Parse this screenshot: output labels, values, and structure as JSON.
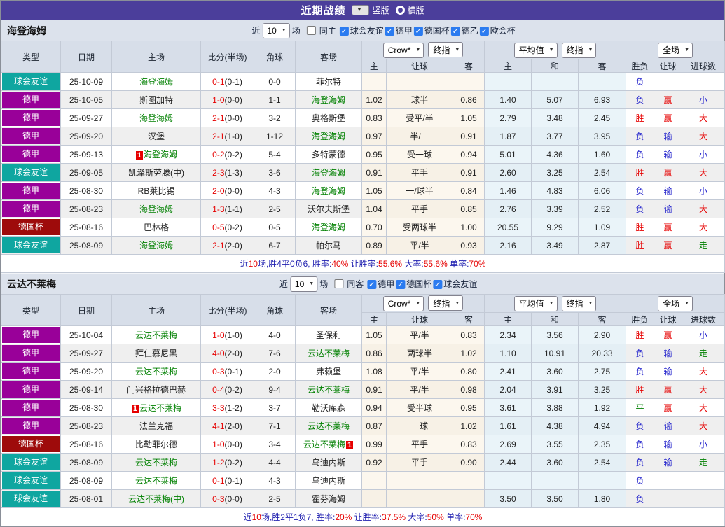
{
  "title_bar": {
    "title": "近期战绩",
    "layout_vertical_label": "竖版",
    "layout_horizontal_label": "横版",
    "selected_layout": "竖版"
  },
  "filter_labels": {
    "near": "近",
    "games": "场"
  },
  "selects": {
    "count": "10",
    "crow": "Crow*",
    "final": "终指",
    "avg": "平均值",
    "final2": "终指",
    "fulltime": "全场"
  },
  "table_labels": {
    "type": "类型",
    "date": "日期",
    "home": "主场",
    "score": "比分(半场)",
    "corner": "角球",
    "away": "客场",
    "h": "主",
    "handicap": "让球",
    "a": "客",
    "avg_h": "主",
    "draw": "和",
    "avg_a": "客",
    "wdl": "胜负",
    "handicap_res": "让球",
    "goals": "进球数"
  },
  "colors": {
    "titlebar": "#4b3e9b",
    "focus_team": "#008000",
    "score_red": "#e60000",
    "badge_red": "#e60000",
    "type_colors": {
      "球会友谊": "#0fa6a0",
      "德甲": "#990099",
      "德国杯": "#9e0b0b"
    },
    "result_colors": {
      "胜": "#e60000",
      "赢": "#e60000",
      "大": "#e60000",
      "负": "#2323cc",
      "输": "#2323cc",
      "小": "#2323cc",
      "平": "#008000",
      "走": "#008000"
    }
  },
  "sections": [
    {
      "team": "海登海姆",
      "filter": {
        "same_label": "同主",
        "same_checked": false,
        "leagues": [
          "球会友谊",
          "德甲",
          "德国杯",
          "德乙",
          "欧会杯"
        ]
      },
      "rows": [
        {
          "type": "球会友谊",
          "date": "25-10-09",
          "home": "海登海姆",
          "home_badge": "",
          "score_ft": "0-1",
          "score_ht": "(0-1)",
          "corners": "0-0",
          "away": "菲尔特",
          "away_badge": "",
          "crow": [
            "",
            "",
            ""
          ],
          "avg": [
            "",
            "",
            ""
          ],
          "result": [
            "负",
            "",
            ""
          ]
        },
        {
          "type": "德甲",
          "date": "25-10-05",
          "home": "斯图加特",
          "home_badge": "",
          "score_ft": "1-0",
          "score_ht": "(0-0)",
          "corners": "1-1",
          "away": "海登海姆",
          "away_badge": "",
          "crow": [
            "1.02",
            "球半",
            "0.86"
          ],
          "avg": [
            "1.40",
            "5.07",
            "6.93"
          ],
          "result": [
            "负",
            "赢",
            "小"
          ]
        },
        {
          "type": "德甲",
          "date": "25-09-27",
          "home": "海登海姆",
          "home_badge": "",
          "score_ft": "2-1",
          "score_ht": "(0-0)",
          "corners": "3-2",
          "away": "奥格斯堡",
          "away_badge": "",
          "crow": [
            "0.83",
            "受平/半",
            "1.05"
          ],
          "avg": [
            "2.79",
            "3.48",
            "2.45"
          ],
          "result": [
            "胜",
            "赢",
            "大"
          ]
        },
        {
          "type": "德甲",
          "date": "25-09-20",
          "home": "汉堡",
          "home_badge": "",
          "score_ft": "2-1",
          "score_ht": "(1-0)",
          "corners": "1-12",
          "away": "海登海姆",
          "away_badge": "",
          "crow": [
            "0.97",
            "半/一",
            "0.91"
          ],
          "avg": [
            "1.87",
            "3.77",
            "3.95"
          ],
          "result": [
            "负",
            "输",
            "大"
          ]
        },
        {
          "type": "德甲",
          "date": "25-09-13",
          "home": "海登海姆",
          "home_badge": "1",
          "score_ft": "0-2",
          "score_ht": "(0-2)",
          "corners": "5-4",
          "away": "多特蒙德",
          "away_badge": "",
          "crow": [
            "0.95",
            "受一球",
            "0.94"
          ],
          "avg": [
            "5.01",
            "4.36",
            "1.60"
          ],
          "result": [
            "负",
            "输",
            "小"
          ]
        },
        {
          "type": "球会友谊",
          "date": "25-09-05",
          "home": "凯泽斯劳滕(中)",
          "home_badge": "",
          "score_ft": "2-3",
          "score_ht": "(1-3)",
          "corners": "3-6",
          "away": "海登海姆",
          "away_badge": "",
          "crow": [
            "0.91",
            "平手",
            "0.91"
          ],
          "avg": [
            "2.60",
            "3.25",
            "2.54"
          ],
          "result": [
            "胜",
            "赢",
            "大"
          ]
        },
        {
          "type": "德甲",
          "date": "25-08-30",
          "home": "RB莱比锡",
          "home_badge": "",
          "score_ft": "2-0",
          "score_ht": "(0-0)",
          "corners": "4-3",
          "away": "海登海姆",
          "away_badge": "",
          "crow": [
            "1.05",
            "一/球半",
            "0.84"
          ],
          "avg": [
            "1.46",
            "4.83",
            "6.06"
          ],
          "result": [
            "负",
            "输",
            "小"
          ]
        },
        {
          "type": "德甲",
          "date": "25-08-23",
          "home": "海登海姆",
          "home_badge": "",
          "score_ft": "1-3",
          "score_ht": "(1-1)",
          "corners": "2-5",
          "away": "沃尔夫斯堡",
          "away_badge": "",
          "crow": [
            "1.04",
            "平手",
            "0.85"
          ],
          "avg": [
            "2.76",
            "3.39",
            "2.52"
          ],
          "result": [
            "负",
            "输",
            "大"
          ]
        },
        {
          "type": "德国杯",
          "date": "25-08-16",
          "home": "巴林格",
          "home_badge": "",
          "score_ft": "0-5",
          "score_ht": "(0-2)",
          "corners": "0-5",
          "away": "海登海姆",
          "away_badge": "",
          "crow": [
            "0.70",
            "受两球半",
            "1.00"
          ],
          "avg": [
            "20.55",
            "9.29",
            "1.09"
          ],
          "result": [
            "胜",
            "赢",
            "大"
          ]
        },
        {
          "type": "球会友谊",
          "date": "25-08-09",
          "home": "海登海姆",
          "home_badge": "",
          "score_ft": "2-1",
          "score_ht": "(2-0)",
          "corners": "6-7",
          "away": "帕尔马",
          "away_badge": "",
          "crow": [
            "0.89",
            "平/半",
            "0.93"
          ],
          "avg": [
            "2.16",
            "3.49",
            "2.87"
          ],
          "result": [
            "胜",
            "赢",
            "走"
          ]
        }
      ],
      "summary": [
        [
          "近",
          "n"
        ],
        [
          "10",
          "r"
        ],
        [
          "场,胜4平0负6, 胜率:",
          "n"
        ],
        [
          "40%",
          "r"
        ],
        [
          " 让胜率:",
          "n"
        ],
        [
          "55.6%",
          "r"
        ],
        [
          " 大率:",
          "n"
        ],
        [
          "55.6%",
          "r"
        ],
        [
          " 单率:",
          "n"
        ],
        [
          "70%",
          "r"
        ]
      ]
    },
    {
      "team": "云达不莱梅",
      "filter": {
        "same_label": "同客",
        "same_checked": false,
        "leagues": [
          "德甲",
          "德国杯",
          "球会友谊"
        ]
      },
      "rows": [
        {
          "type": "德甲",
          "date": "25-10-04",
          "home": "云达不莱梅",
          "home_badge": "",
          "score_ft": "1-0",
          "score_ht": "(1-0)",
          "corners": "4-0",
          "away": "圣保利",
          "away_badge": "",
          "crow": [
            "1.05",
            "平/半",
            "0.83"
          ],
          "avg": [
            "2.34",
            "3.56",
            "2.90"
          ],
          "result": [
            "胜",
            "赢",
            "小"
          ]
        },
        {
          "type": "德甲",
          "date": "25-09-27",
          "home": "拜仁慕尼黑",
          "home_badge": "",
          "score_ft": "4-0",
          "score_ht": "(2-0)",
          "corners": "7-6",
          "away": "云达不莱梅",
          "away_badge": "",
          "crow": [
            "0.86",
            "两球半",
            "1.02"
          ],
          "avg": [
            "1.10",
            "10.91",
            "20.33"
          ],
          "result": [
            "负",
            "输",
            "走"
          ]
        },
        {
          "type": "德甲",
          "date": "25-09-20",
          "home": "云达不莱梅",
          "home_badge": "",
          "score_ft": "0-3",
          "score_ht": "(0-1)",
          "corners": "2-0",
          "away": "弗赖堡",
          "away_badge": "",
          "crow": [
            "1.08",
            "平/半",
            "0.80"
          ],
          "avg": [
            "2.41",
            "3.60",
            "2.75"
          ],
          "result": [
            "负",
            "输",
            "大"
          ]
        },
        {
          "type": "德甲",
          "date": "25-09-14",
          "home": "门兴格拉德巴赫",
          "home_badge": "",
          "score_ft": "0-4",
          "score_ht": "(0-2)",
          "corners": "9-4",
          "away": "云达不莱梅",
          "away_badge": "",
          "crow": [
            "0.91",
            "平/半",
            "0.98"
          ],
          "avg": [
            "2.04",
            "3.91",
            "3.25"
          ],
          "result": [
            "胜",
            "赢",
            "大"
          ]
        },
        {
          "type": "德甲",
          "date": "25-08-30",
          "home": "云达不莱梅",
          "home_badge": "1",
          "score_ft": "3-3",
          "score_ht": "(1-2)",
          "corners": "3-7",
          "away": "勒沃库森",
          "away_badge": "",
          "crow": [
            "0.94",
            "受半球",
            "0.95"
          ],
          "avg": [
            "3.61",
            "3.88",
            "1.92"
          ],
          "result": [
            "平",
            "赢",
            "大"
          ]
        },
        {
          "type": "德甲",
          "date": "25-08-23",
          "home": "法兰克福",
          "home_badge": "",
          "score_ft": "4-1",
          "score_ht": "(2-0)",
          "corners": "7-1",
          "away": "云达不莱梅",
          "away_badge": "",
          "crow": [
            "0.87",
            "一球",
            "1.02"
          ],
          "avg": [
            "1.61",
            "4.38",
            "4.94"
          ],
          "result": [
            "负",
            "输",
            "大"
          ]
        },
        {
          "type": "德国杯",
          "date": "25-08-16",
          "home": "比勒菲尔德",
          "home_badge": "",
          "score_ft": "1-0",
          "score_ht": "(0-0)",
          "corners": "3-4",
          "away": "云达不莱梅",
          "away_badge": "1",
          "crow": [
            "0.99",
            "平手",
            "0.83"
          ],
          "avg": [
            "2.69",
            "3.55",
            "2.35"
          ],
          "result": [
            "负",
            "输",
            "小"
          ]
        },
        {
          "type": "球会友谊",
          "date": "25-08-09",
          "home": "云达不莱梅",
          "home_badge": "",
          "score_ft": "1-2",
          "score_ht": "(0-2)",
          "corners": "4-4",
          "away": "乌迪内斯",
          "away_badge": "",
          "crow": [
            "0.92",
            "平手",
            "0.90"
          ],
          "avg": [
            "2.44",
            "3.60",
            "2.54"
          ],
          "result": [
            "负",
            "输",
            "走"
          ]
        },
        {
          "type": "球会友谊",
          "date": "25-08-09",
          "home": "云达不莱梅",
          "home_badge": "",
          "score_ft": "0-1",
          "score_ht": "(0-1)",
          "corners": "4-3",
          "away": "乌迪内斯",
          "away_badge": "",
          "crow": [
            "",
            "",
            ""
          ],
          "avg": [
            "",
            "",
            ""
          ],
          "result": [
            "负",
            "",
            ""
          ]
        },
        {
          "type": "球会友谊",
          "date": "25-08-01",
          "home": "云达不莱梅(中)",
          "home_badge": "",
          "score_ft": "0-3",
          "score_ht": "(0-0)",
          "corners": "2-5",
          "away": "霍芬海姆",
          "away_badge": "",
          "crow": [
            "",
            "",
            ""
          ],
          "avg": [
            "3.50",
            "3.50",
            "1.80"
          ],
          "result": [
            "负",
            "",
            ""
          ]
        }
      ],
      "summary": [
        [
          "近",
          "n"
        ],
        [
          "10",
          "r"
        ],
        [
          "场,胜2平1负7, 胜率:",
          "n"
        ],
        [
          "20%",
          "r"
        ],
        [
          " 让胜率:",
          "n"
        ],
        [
          "37.5%",
          "r"
        ],
        [
          " 大率:",
          "n"
        ],
        [
          "50%",
          "r"
        ],
        [
          " 单率:",
          "n"
        ],
        [
          "70%",
          "r"
        ]
      ]
    }
  ]
}
